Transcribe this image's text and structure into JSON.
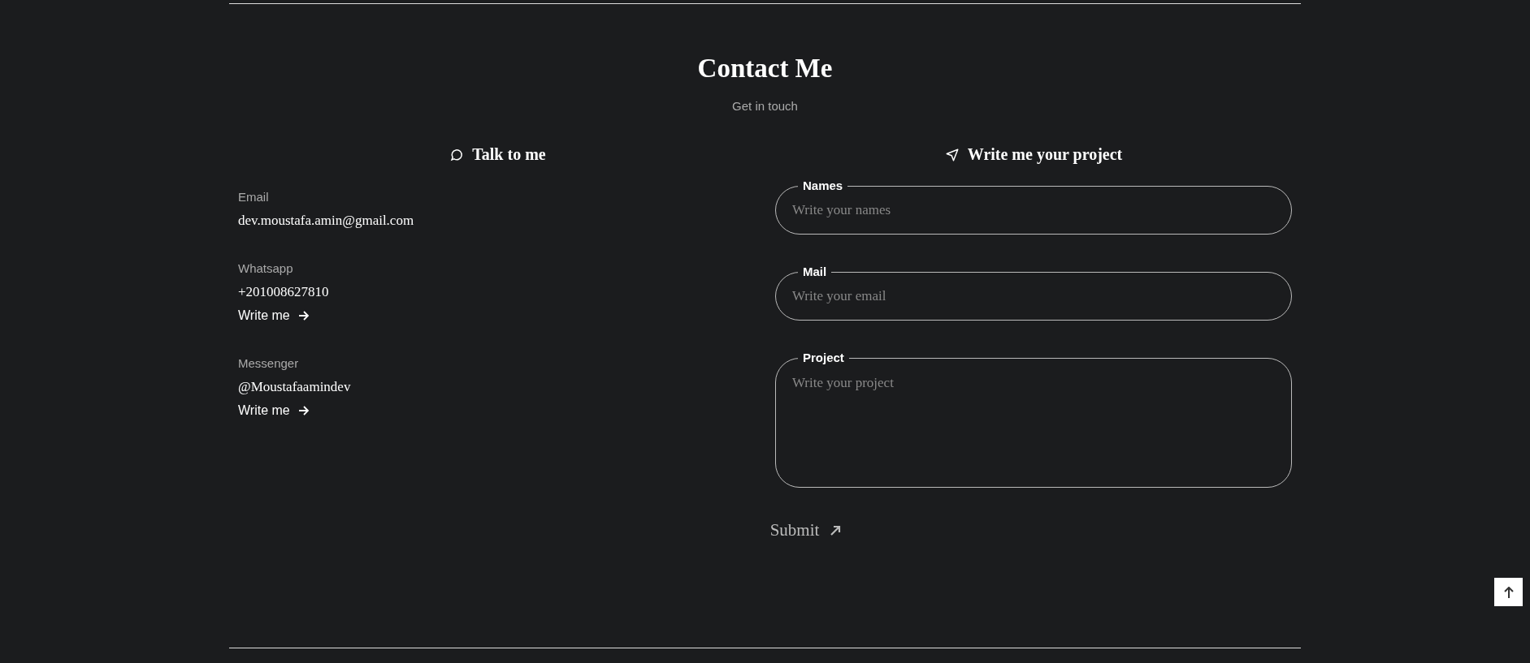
{
  "header": {
    "title": "Contact Me",
    "subtitle": "Get in touch"
  },
  "contact": {
    "heading": "Talk to me",
    "methods": [
      {
        "label": "Email",
        "value": "dev.moustafa.amin@gmail.com"
      },
      {
        "label": "Whatsapp",
        "value": "+201008627810",
        "link": "Write me"
      },
      {
        "label": "Messenger",
        "value": "@Moustafaamindev",
        "link": "Write me"
      }
    ]
  },
  "form": {
    "heading": "Write me your project",
    "fields": [
      {
        "kind": "input",
        "label": "Names",
        "placeholder": "Write your names"
      },
      {
        "kind": "input",
        "label": "Mail",
        "placeholder": "Write your email"
      },
      {
        "kind": "textarea",
        "label": "Project",
        "placeholder": "Write your project"
      }
    ],
    "submit": "Submit"
  }
}
